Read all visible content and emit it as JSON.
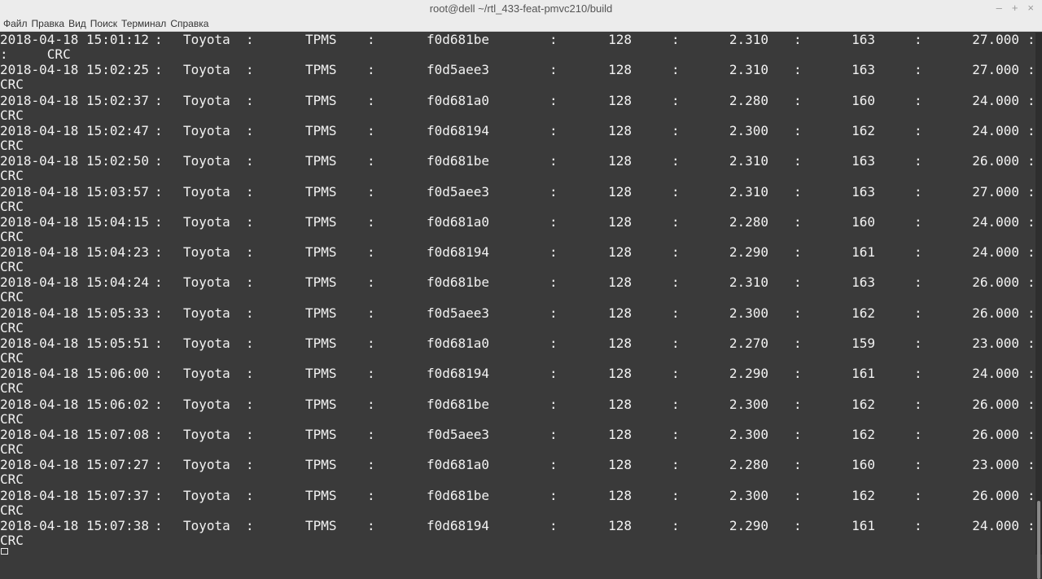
{
  "window": {
    "title": "root@dell ~/rtl_433-feat-pmvc210/build",
    "controls": [
      "–",
      "+",
      "×"
    ]
  },
  "menu": [
    "Файл",
    "Правка",
    "Вид",
    "Поиск",
    "Терминал",
    "Справка"
  ],
  "separator": ":",
  "rows": [
    {
      "date": "2018-04-18 15:01:12",
      "make": "Toyota",
      "type": "TPMS",
      "id": "f0d681be",
      "n1": "128",
      "n2": "2.310",
      "n3": "163",
      "n4": "27.000",
      "crc": ":     CRC"
    },
    {
      "date": "2018-04-18 15:02:25",
      "make": "Toyota",
      "type": "TPMS",
      "id": "f0d5aee3",
      "n1": "128",
      "n2": "2.310",
      "n3": "163",
      "n4": "27.000",
      "crc": "CRC"
    },
    {
      "date": "2018-04-18 15:02:37",
      "make": "Toyota",
      "type": "TPMS",
      "id": "f0d681a0",
      "n1": "128",
      "n2": "2.280",
      "n3": "160",
      "n4": "24.000",
      "crc": "CRC"
    },
    {
      "date": "2018-04-18 15:02:47",
      "make": "Toyota",
      "type": "TPMS",
      "id": "f0d68194",
      "n1": "128",
      "n2": "2.300",
      "n3": "162",
      "n4": "24.000",
      "crc": "CRC"
    },
    {
      "date": "2018-04-18 15:02:50",
      "make": "Toyota",
      "type": "TPMS",
      "id": "f0d681be",
      "n1": "128",
      "n2": "2.310",
      "n3": "163",
      "n4": "26.000",
      "crc": "CRC"
    },
    {
      "date": "2018-04-18 15:03:57",
      "make": "Toyota",
      "type": "TPMS",
      "id": "f0d5aee3",
      "n1": "128",
      "n2": "2.310",
      "n3": "163",
      "n4": "27.000",
      "crc": "CRC"
    },
    {
      "date": "2018-04-18 15:04:15",
      "make": "Toyota",
      "type": "TPMS",
      "id": "f0d681a0",
      "n1": "128",
      "n2": "2.280",
      "n3": "160",
      "n4": "24.000",
      "crc": "CRC"
    },
    {
      "date": "2018-04-18 15:04:23",
      "make": "Toyota",
      "type": "TPMS",
      "id": "f0d68194",
      "n1": "128",
      "n2": "2.290",
      "n3": "161",
      "n4": "24.000",
      "crc": "CRC"
    },
    {
      "date": "2018-04-18 15:04:24",
      "make": "Toyota",
      "type": "TPMS",
      "id": "f0d681be",
      "n1": "128",
      "n2": "2.310",
      "n3": "163",
      "n4": "26.000",
      "crc": "CRC"
    },
    {
      "date": "2018-04-18 15:05:33",
      "make": "Toyota",
      "type": "TPMS",
      "id": "f0d5aee3",
      "n1": "128",
      "n2": "2.300",
      "n3": "162",
      "n4": "26.000",
      "crc": "CRC"
    },
    {
      "date": "2018-04-18 15:05:51",
      "make": "Toyota",
      "type": "TPMS",
      "id": "f0d681a0",
      "n1": "128",
      "n2": "2.270",
      "n3": "159",
      "n4": "23.000",
      "crc": "CRC"
    },
    {
      "date": "2018-04-18 15:06:00",
      "make": "Toyota",
      "type": "TPMS",
      "id": "f0d68194",
      "n1": "128",
      "n2": "2.290",
      "n3": "161",
      "n4": "24.000",
      "crc": "CRC"
    },
    {
      "date": "2018-04-18 15:06:02",
      "make": "Toyota",
      "type": "TPMS",
      "id": "f0d681be",
      "n1": "128",
      "n2": "2.300",
      "n3": "162",
      "n4": "26.000",
      "crc": "CRC"
    },
    {
      "date": "2018-04-18 15:07:08",
      "make": "Toyota",
      "type": "TPMS",
      "id": "f0d5aee3",
      "n1": "128",
      "n2": "2.300",
      "n3": "162",
      "n4": "26.000",
      "crc": "CRC"
    },
    {
      "date": "2018-04-18 15:07:27",
      "make": "Toyota",
      "type": "TPMS",
      "id": "f0d681a0",
      "n1": "128",
      "n2": "2.280",
      "n3": "160",
      "n4": "23.000",
      "crc": "CRC"
    },
    {
      "date": "2018-04-18 15:07:37",
      "make": "Toyota",
      "type": "TPMS",
      "id": "f0d681be",
      "n1": "128",
      "n2": "2.300",
      "n3": "162",
      "n4": "26.000",
      "crc": "CRC"
    },
    {
      "date": "2018-04-18 15:07:38",
      "make": "Toyota",
      "type": "TPMS",
      "id": "f0d68194",
      "n1": "128",
      "n2": "2.290",
      "n3": "161",
      "n4": "24.000",
      "crc": "CRC"
    }
  ]
}
